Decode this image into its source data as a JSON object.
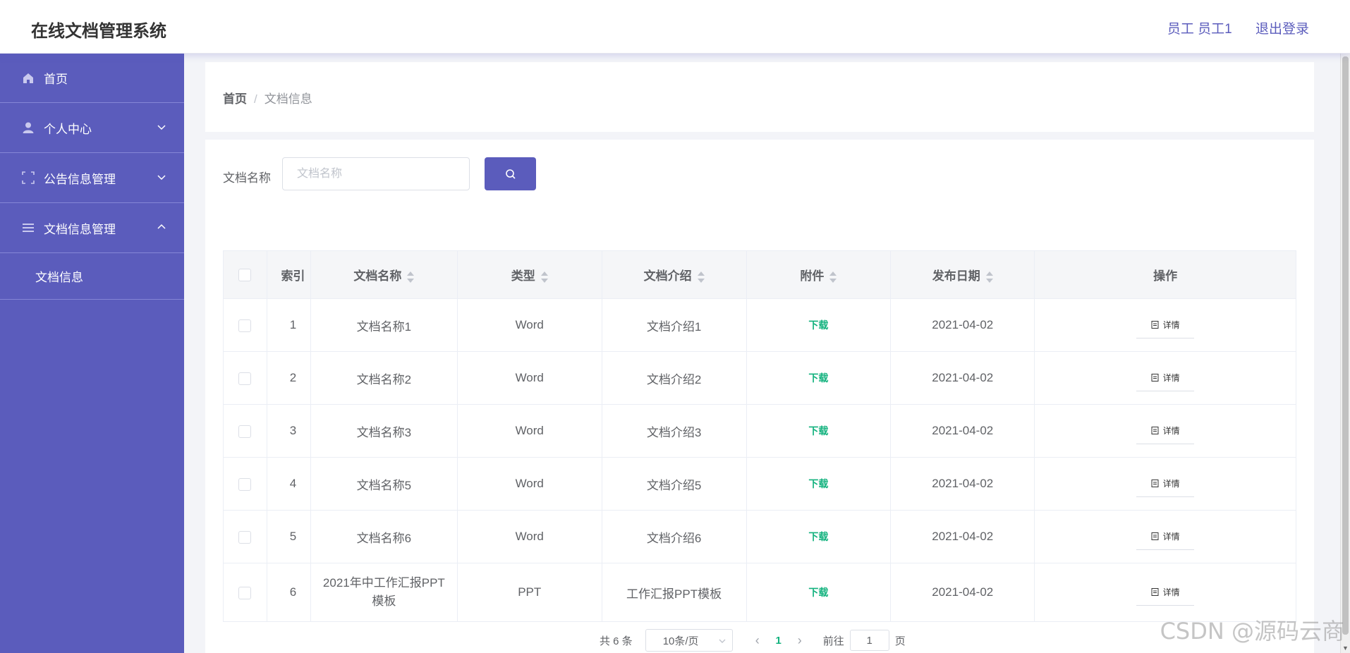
{
  "header": {
    "title": "在线文档管理系统",
    "user_label": "员工 员工1",
    "logout_label": "退出登录"
  },
  "sidebar": {
    "items": [
      {
        "label": "首页",
        "icon": "home-icon"
      },
      {
        "label": "个人中心",
        "icon": "user-icon"
      },
      {
        "label": "公告信息管理",
        "icon": "frame-icon"
      },
      {
        "label": "文档信息管理",
        "icon": "list-icon"
      }
    ],
    "sub_items": [
      {
        "label": "文档信息"
      }
    ]
  },
  "breadcrumb": {
    "home": "首页",
    "separator": "/",
    "current": "文档信息"
  },
  "search": {
    "label": "文档名称",
    "placeholder": "文档名称"
  },
  "table": {
    "columns": [
      "索引",
      "文档名称",
      "类型",
      "文档介绍",
      "附件",
      "发布日期",
      "操作"
    ],
    "download_label": "下载",
    "detail_label": "详情",
    "rows": [
      {
        "index": "1",
        "name": "文档名称1",
        "type": "Word",
        "intro": "文档介绍1",
        "date": "2021-04-02"
      },
      {
        "index": "2",
        "name": "文档名称2",
        "type": "Word",
        "intro": "文档介绍2",
        "date": "2021-04-02"
      },
      {
        "index": "3",
        "name": "文档名称3",
        "type": "Word",
        "intro": "文档介绍3",
        "date": "2021-04-02"
      },
      {
        "index": "4",
        "name": "文档名称5",
        "type": "Word",
        "intro": "文档介绍5",
        "date": "2021-04-02"
      },
      {
        "index": "5",
        "name": "文档名称6",
        "type": "Word",
        "intro": "文档介绍6",
        "date": "2021-04-02"
      },
      {
        "index": "6",
        "name": "2021年中工作汇报PPT模板",
        "type": "PPT",
        "intro": "工作汇报PPT模板",
        "date": "2021-04-02"
      }
    ]
  },
  "pagination": {
    "total": "共 6 条",
    "page_size": "10条/页",
    "current_page": "1",
    "goto_prefix": "前往",
    "goto_value": "1",
    "goto_suffix": "页"
  },
  "watermark": "CSDN @源码云商",
  "colors": {
    "accent": "#5b5cbc",
    "download": "#13b27e"
  }
}
